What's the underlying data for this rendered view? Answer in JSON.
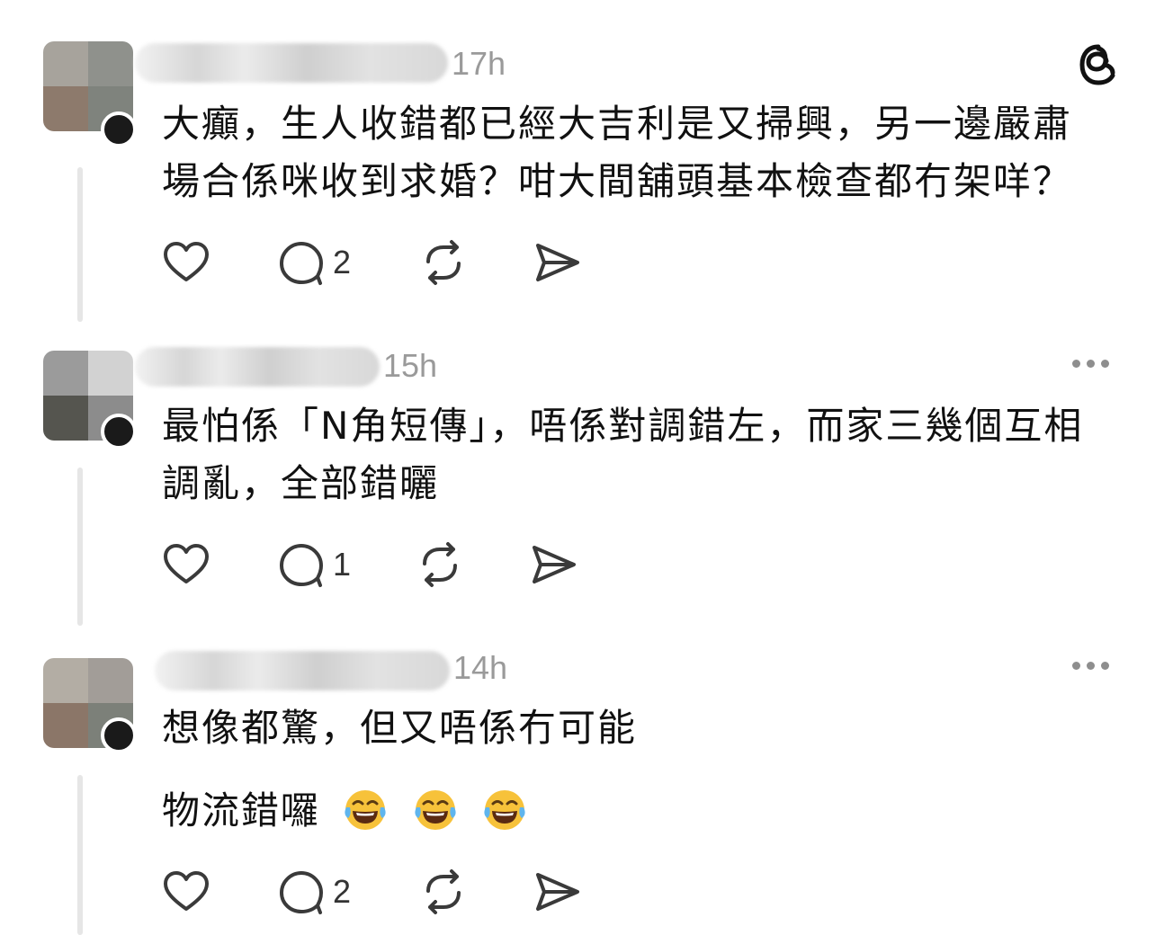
{
  "posts": [
    {
      "time": "17h",
      "text_lines": [
        "大癲，生人收錯都已經大吉利是又掃興，另一邊嚴肅",
        "場合係咪收到求婚？咁大間舖頭基本檢查都冇架咩？"
      ],
      "reply_count": "2"
    },
    {
      "time": "15h",
      "text_lines": [
        "最怕係「N角短傳」，唔係對調錯左，而家三幾個互相",
        "調亂，全部錯曬"
      ],
      "reply_count": "1"
    },
    {
      "time": "14h",
      "text_lines": [
        "想像都驚，但又唔係冇可能"
      ],
      "text_line2": "物流錯囉",
      "reply_count": "2",
      "emojis": [
        "face-with-tears-of-joy-icon",
        "face-with-tears-of-joy-icon",
        "face-with-tears-of-joy-icon"
      ]
    }
  ],
  "icons": {
    "logo": "threads-logo-icon",
    "like": "heart-icon",
    "reply": "comment-bubble-icon",
    "repost": "repost-icon",
    "share": "send-icon",
    "more": "more-options-icon"
  },
  "colors": {
    "text": "#111111",
    "meta": "#9a9a9a",
    "thread_line": "#e6e6e6",
    "icon_stroke": "#3a3a3a"
  }
}
